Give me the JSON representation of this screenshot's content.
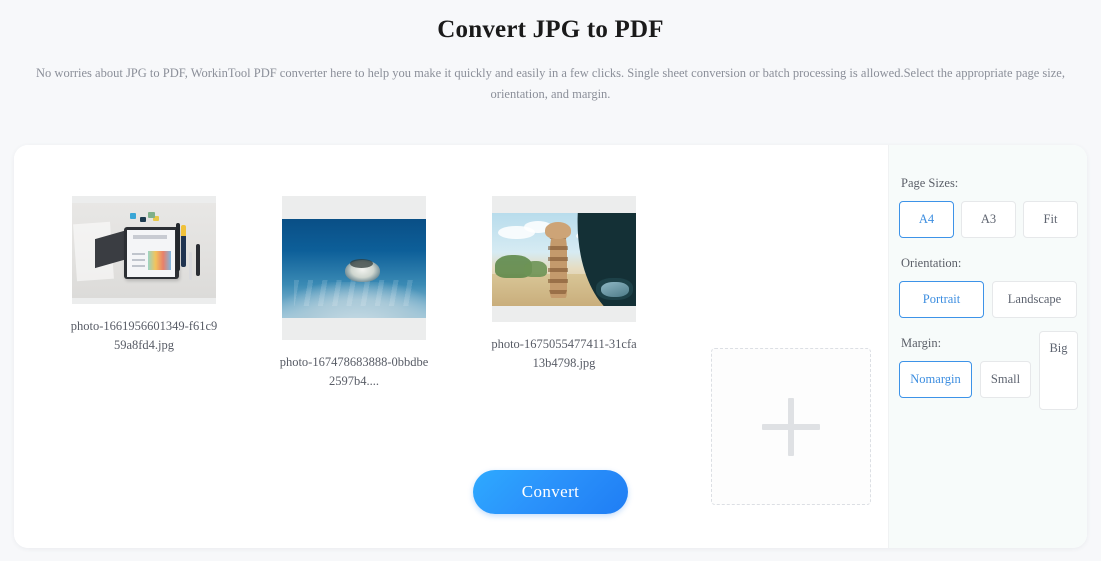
{
  "header": {
    "title": "Convert JPG to PDF",
    "description": "No worries about JPG to PDF, WorkinTool PDF converter here to help you make it quickly and easily in a few clicks. Single sheet conversion or batch processing is allowed.Select the appropriate page size, orientation, and margin."
  },
  "files": [
    {
      "name": "photo-1661956601349-f61c959a8fd4.jpg",
      "art": "desk"
    },
    {
      "name": "photo-167478683888-0bbdbe2597b4....",
      "art": "sea"
    },
    {
      "name": "photo-1675055477411-31cfa13b4798.jpg",
      "art": "safari"
    }
  ],
  "add_tile": {
    "icon": "plus-icon"
  },
  "convert": {
    "label": "Convert"
  },
  "settings": {
    "page_sizes": {
      "label": "Page Sizes:",
      "options": [
        "A4",
        "A3",
        "Fit"
      ],
      "selected": "A4"
    },
    "orientation": {
      "label": "Orientation:",
      "options": [
        "Portrait",
        "Landscape"
      ],
      "selected": "Portrait"
    },
    "margin": {
      "label": "Margin:",
      "options": [
        "Nomargin",
        "Small",
        "Big"
      ],
      "selected": "Nomargin"
    }
  },
  "colors": {
    "accent": "#3d8ee0",
    "convert_button": "#2b93fb",
    "page_background": "#f7f8fa",
    "card_background": "#ffffff",
    "settings_background": "#f7fbfa",
    "tile_background": "#eceded"
  }
}
